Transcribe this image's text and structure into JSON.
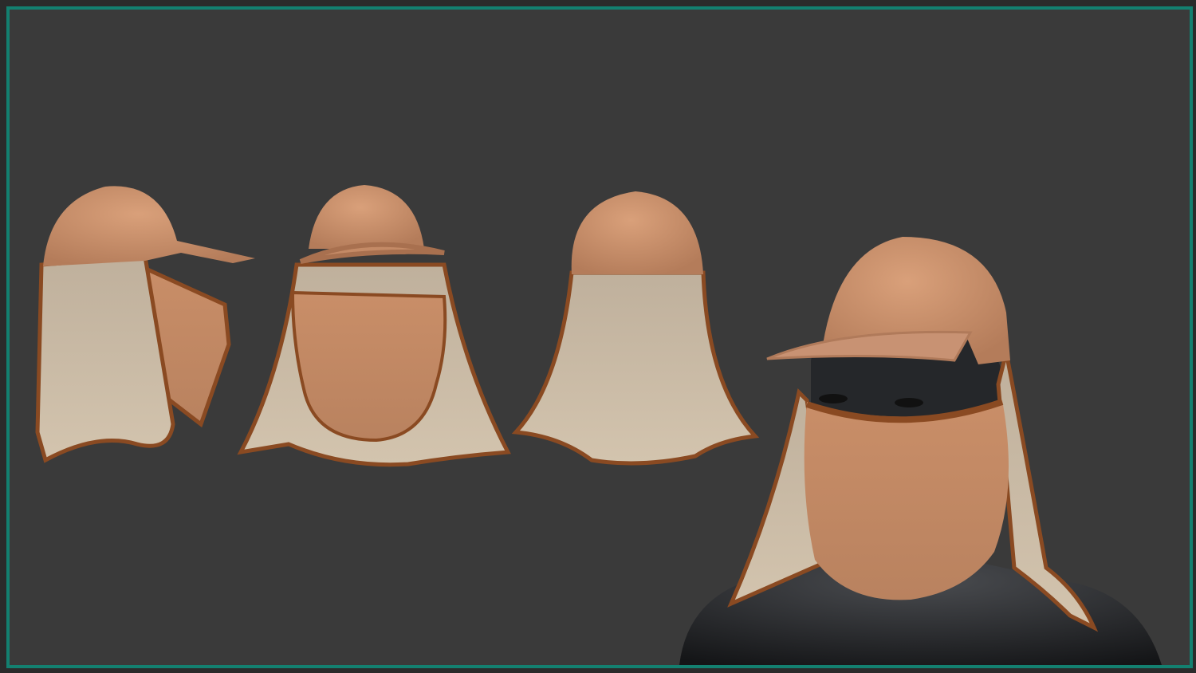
{
  "scene": {
    "subject": "cap-with-neck-flap-and-face-mask",
    "colors": {
      "frame": "#138070",
      "background": "#3a3a3a",
      "cap_fabric": "#c8906c",
      "flap_fabric": "#c9b9a3",
      "piping": "#8a4a22",
      "mannequin": "#1e1f22"
    }
  }
}
